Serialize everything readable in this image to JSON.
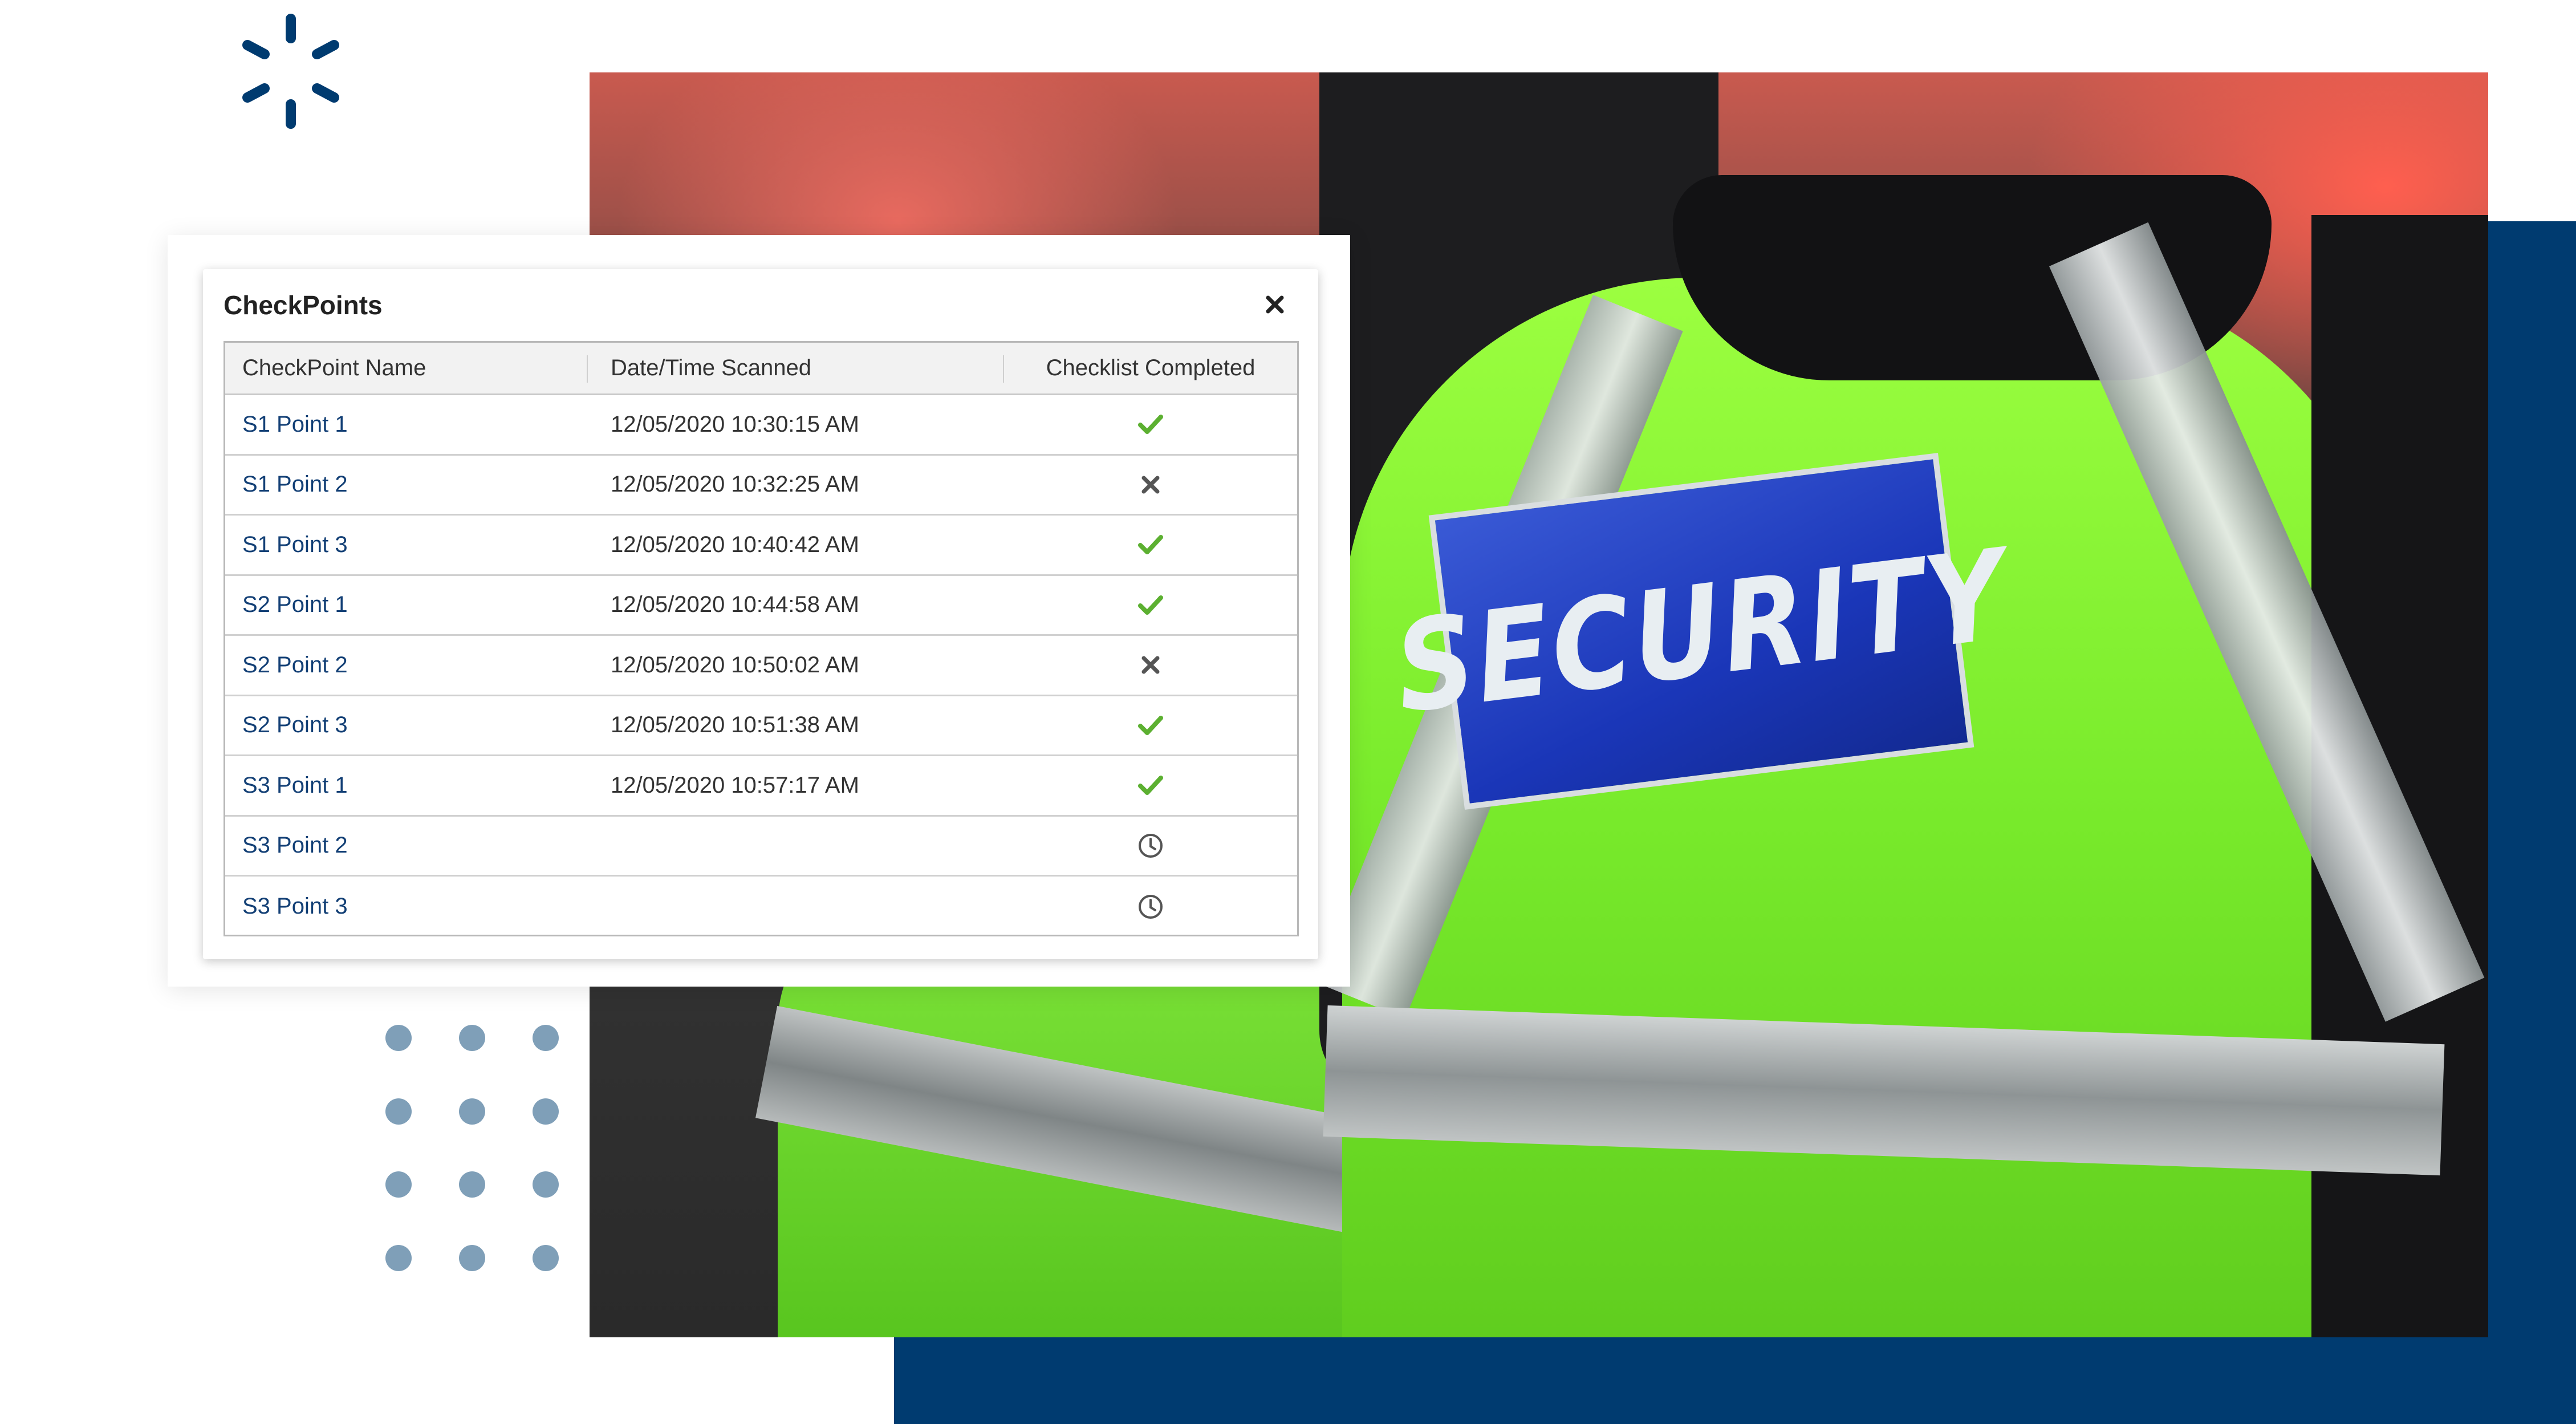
{
  "colors": {
    "navy": "#003b70",
    "link": "#123f75",
    "check_green": "#5cb031",
    "cross_gray": "#555555",
    "dot_gray_blue": "#7f9fb8"
  },
  "card": {
    "title": "CheckPoints",
    "close_icon": "close-icon"
  },
  "table": {
    "headers": [
      "CheckPoint Name",
      "Date/Time Scanned",
      "Checklist Completed"
    ],
    "rows": [
      {
        "name": "S1 Point 1",
        "scanned": "12/05/2020 10:30:15 AM",
        "status": "check"
      },
      {
        "name": "S1 Point 2",
        "scanned": "12/05/2020 10:32:25 AM",
        "status": "cross"
      },
      {
        "name": "S1 Point 3",
        "scanned": "12/05/2020 10:40:42 AM",
        "status": "check"
      },
      {
        "name": "S2 Point 1",
        "scanned": "12/05/2020 10:44:58 AM",
        "status": "check"
      },
      {
        "name": "S2 Point 2",
        "scanned": "12/05/2020 10:50:02 AM",
        "status": "cross"
      },
      {
        "name": "S2 Point 3",
        "scanned": "12/05/2020 10:51:38 AM",
        "status": "check"
      },
      {
        "name": "S3 Point 1",
        "scanned": "12/05/2020 10:57:17 AM",
        "status": "check"
      },
      {
        "name": "S3 Point 2",
        "scanned": "",
        "status": "pending"
      },
      {
        "name": "S3 Point 3",
        "scanned": "",
        "status": "pending"
      }
    ]
  },
  "photo": {
    "patch_text": "SECURITY"
  }
}
